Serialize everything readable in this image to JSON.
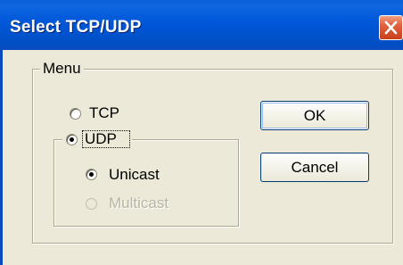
{
  "window": {
    "title": "Select TCP/UDP"
  },
  "menu_group": {
    "legend": "Menu",
    "tcp_label": "TCP",
    "udp_label": "UDP",
    "udp_options": {
      "unicast_label": "Unicast",
      "multicast_label": "Multicast"
    }
  },
  "buttons": {
    "ok_label": "OK",
    "cancel_label": "Cancel"
  },
  "state": {
    "selected_protocol": "UDP",
    "selected_udp_mode": "Unicast",
    "multicast_enabled": false
  },
  "icons": {
    "close": "close-icon"
  },
  "colors": {
    "titlebar": "#0057d8",
    "close_button": "#e06040",
    "dialog_bg": "#ece9d8"
  }
}
